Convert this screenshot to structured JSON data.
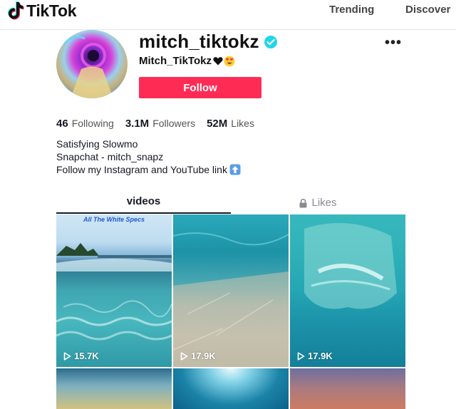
{
  "header": {
    "logo_text": "TikTok",
    "nav": [
      "Trending",
      "Discover"
    ]
  },
  "profile": {
    "username": "mitch_tiktokz",
    "nickname": "Mitch_TikTokz",
    "follow_label": "Follow",
    "more_label": "•••",
    "stats": [
      {
        "value": "46",
        "label": "Following"
      },
      {
        "value": "3.1M",
        "label": "Followers"
      },
      {
        "value": "52M",
        "label": "Likes"
      }
    ],
    "bio": [
      "Satisfying Slowmo",
      "Snapchat - mitch_snapz",
      "Follow my Instagram and YouTube link"
    ]
  },
  "tabs": {
    "videos": "videos",
    "likes": "Likes"
  },
  "videos": [
    {
      "caption": "All The White Specs",
      "plays": "15.7K"
    },
    {
      "caption": "",
      "plays": "17.9K"
    },
    {
      "caption": "",
      "plays": "17.9K"
    },
    {
      "caption": "",
      "plays": ""
    },
    {
      "caption": "",
      "plays": ""
    },
    {
      "caption": "",
      "plays": ""
    }
  ],
  "colors": {
    "accent": "#fe2c55",
    "verified": "#20d5ec",
    "text": "#161823",
    "muted": "#8a8b91"
  },
  "icons": [
    "tiktok-logo-icon",
    "verified-badge-icon",
    "more-options-icon",
    "heart-emoji-icon",
    "heart-eyes-emoji-icon",
    "up-arrow-emoji-icon",
    "lock-icon",
    "play-icon"
  ]
}
